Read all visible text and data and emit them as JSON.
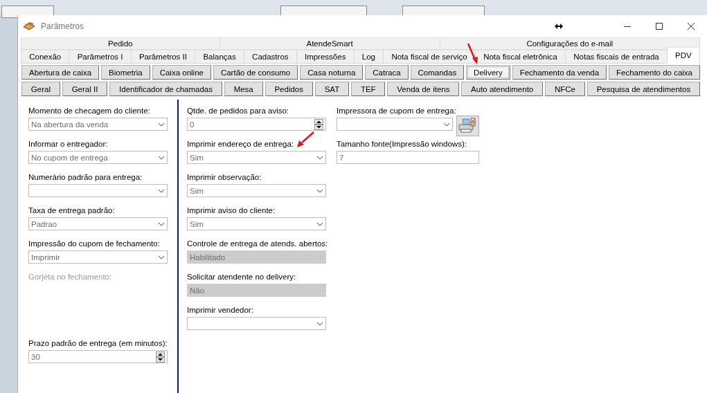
{
  "window": {
    "title": "Parâmetros"
  },
  "tab_rows": [
    {
      "tabs": [
        {
          "label": "Pedido",
          "selected": false
        },
        {
          "label": "AtendeSmart",
          "selected": false
        },
        {
          "label": "Configurações do e-mail",
          "selected": false
        }
      ]
    },
    {
      "tabs": [
        {
          "label": "Conexão",
          "selected": false
        },
        {
          "label": "Parâmetros I",
          "selected": false
        },
        {
          "label": "Parâmetros II",
          "selected": false
        },
        {
          "label": "Balanças",
          "selected": false
        },
        {
          "label": "Cadastros",
          "selected": false
        },
        {
          "label": "Impressões",
          "selected": false
        },
        {
          "label": "Log",
          "selected": false
        },
        {
          "label": "Nota fiscal de serviço",
          "selected": false
        },
        {
          "label": "Nota fiscal eletrônica",
          "selected": false
        },
        {
          "label": "Notas fiscais de entrada",
          "selected": false
        },
        {
          "label": "PDV",
          "selected": true
        }
      ]
    }
  ],
  "section_button_rows": [
    {
      "buttons": [
        {
          "label": "Abertura de caixa",
          "selected": false
        },
        {
          "label": "Biometria",
          "selected": false
        },
        {
          "label": "Caixa online",
          "selected": false
        },
        {
          "label": "Cartão de consumo",
          "selected": false
        },
        {
          "label": "Casa noturna",
          "selected": false
        },
        {
          "label": "Catraca",
          "selected": false
        },
        {
          "label": "Comandas",
          "selected": false
        },
        {
          "label": "Delivery",
          "selected": true
        },
        {
          "label": "Fechamento da venda",
          "selected": false
        },
        {
          "label": "Fechamento do caixa",
          "selected": false
        }
      ]
    },
    {
      "buttons": [
        {
          "label": "Geral",
          "selected": false
        },
        {
          "label": "Geral II",
          "selected": false
        },
        {
          "label": "Identificador de chamadas",
          "selected": false
        },
        {
          "label": "Mesa",
          "selected": false
        },
        {
          "label": "Pedidos",
          "selected": false
        },
        {
          "label": "SAT",
          "selected": false
        },
        {
          "label": "TEF",
          "selected": false
        },
        {
          "label": "Venda de itens",
          "selected": false
        },
        {
          "label": "Auto atendimento",
          "selected": false
        },
        {
          "label": "NFCe",
          "selected": false
        },
        {
          "label": "Pesquisa de atendimentos",
          "selected": false
        }
      ]
    }
  ],
  "columns": [
    {
      "fields": [
        {
          "kind": "combo",
          "label": "Momento de checagem do cliente:",
          "value": "Na abertura da venda",
          "disabled": false
        },
        {
          "kind": "combo",
          "label": "Informar o entregador:",
          "value": "No cupom de entrega",
          "disabled": false
        },
        {
          "kind": "combo",
          "label": "Numerário padrão para entrega:",
          "disabled": false
        },
        {
          "kind": "combo",
          "label": "Taxa de entrega padrão:",
          "value": "Padrao",
          "disabled": false
        },
        {
          "kind": "combo",
          "label": "Impressão do cupom de fechamento:",
          "value": "Imprimir",
          "disabled": false
        },
        {
          "kind": "label",
          "label": "Gorjeta no fechamento:",
          "disabled": true
        },
        {
          "kind": "spin",
          "label": "Prazo padrão de entrega (em minutos):",
          "value": "30",
          "disabled": false
        }
      ]
    },
    {
      "fields": [
        {
          "kind": "spin",
          "label": "Qtde. de pedidos para aviso:",
          "value": "0",
          "disabled": false
        },
        {
          "kind": "combo",
          "label": "Imprimir endereço de entrega:",
          "value": "Sim",
          "disabled": false
        },
        {
          "kind": "combo",
          "label": "Imprimir observação:",
          "value": "Sim",
          "disabled": false
        },
        {
          "kind": "combo",
          "label": "Imprimir aviso do cliente:",
          "value": "Sim",
          "disabled": false
        },
        {
          "kind": "combo",
          "label": "Controle de entrega de atends. abertos:",
          "value": "Habilitado",
          "disabled": true
        },
        {
          "kind": "combo",
          "label": "Solicitar atendente no delivery:",
          "value": "Não",
          "disabled": true
        },
        {
          "kind": "combo",
          "label": "Imprimir vendedor:",
          "disabled": false
        }
      ]
    },
    {
      "fields": [
        {
          "kind": "printer_combo",
          "label": "Impressora de cupom de entrega:",
          "disabled": false
        },
        {
          "kind": "text",
          "label": "Tamanho fonte(Impressão windows):",
          "value": "7",
          "disabled": false
        }
      ]
    }
  ]
}
